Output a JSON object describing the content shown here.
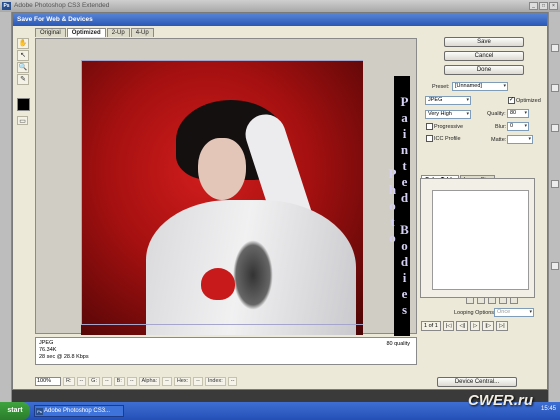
{
  "app": {
    "title": "Adobe Photoshop CS3 Extended",
    "ps_badge": "Ps",
    "win_buttons": [
      "_",
      "□",
      "×"
    ]
  },
  "dialog": {
    "title": "Save For Web & Devices",
    "tabs": [
      "Original",
      "Optimized",
      "2-Up",
      "4-Up"
    ],
    "active_tab": "Optimized"
  },
  "tools": {
    "hand": "✋",
    "slice_select": "↖",
    "zoom": "🔍",
    "eyedropper": "✎",
    "toggle_slices": "▭"
  },
  "image": {
    "vertical_text": "Painted Bodies Photo"
  },
  "info": {
    "format": "JPEG",
    "size": "76.34K",
    "time": "28 sec @ 28.8 Kbps",
    "quality_note": "80 quality"
  },
  "status": {
    "zoom": "100%",
    "r_label": "R:",
    "r_value": "--",
    "g_label": "G:",
    "g_value": "--",
    "b_label": "B:",
    "b_value": "--",
    "alpha_label": "Alpha:",
    "alpha_value": "--",
    "hex_label": "Hex:",
    "hex_value": "--",
    "index_label": "Index:",
    "index_value": "--"
  },
  "buttons": {
    "save": "Save",
    "cancel": "Cancel",
    "done": "Done",
    "device_central": "Device Central..."
  },
  "settings": {
    "preset_label": "Preset:",
    "preset_value": "[Unnamed]",
    "format_value": "JPEG",
    "optimized_label": "Optimized",
    "compression_value": "Very High",
    "quality_label": "Quality:",
    "quality_value": "80",
    "progressive_label": "Progressive",
    "blur_label": "Blur:",
    "blur_value": "0",
    "icc_label": "ICC Profile",
    "matte_label": "Matte:"
  },
  "color_panel": {
    "tab_color_table": "Color Table",
    "tab_image_size": "Image Size"
  },
  "animation": {
    "looping_label": "Looping Options:",
    "looping_value": "Once",
    "frame_counter": "1 of 1"
  },
  "taskbar": {
    "start_label": "start",
    "task_label": "Adobe Photoshop CS3...",
    "watermark": "CWER.ru",
    "clock": "15:45"
  }
}
